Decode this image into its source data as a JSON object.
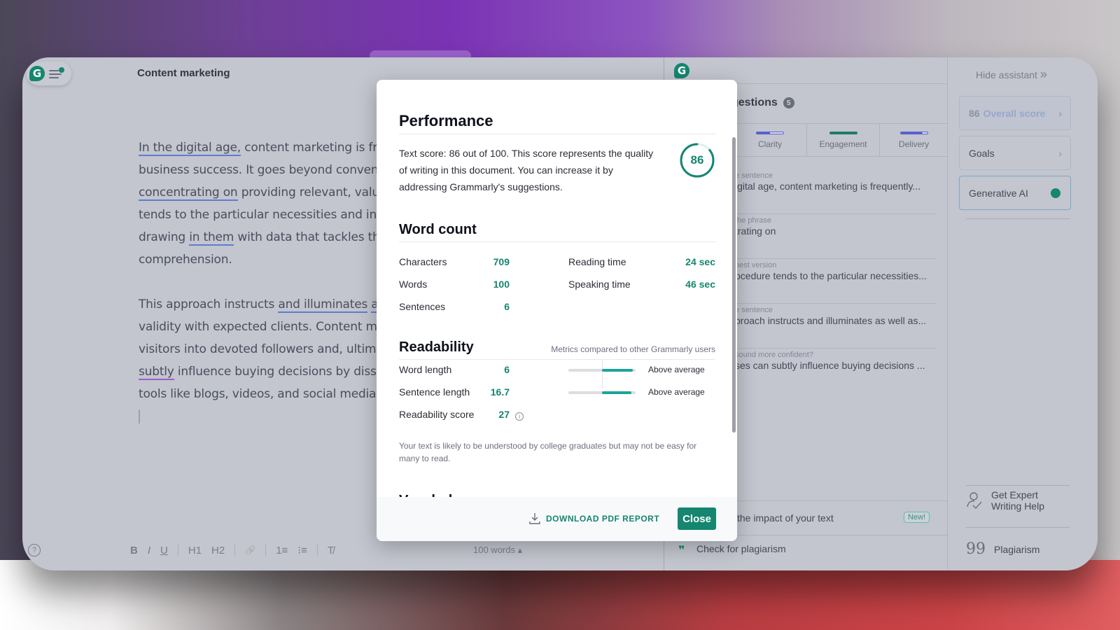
{
  "editor": {
    "doc_title": "Content marketing",
    "paragraph1": {
      "l1": [
        "In the digital age,",
        " content marketing is fre"
      ],
      "l2": "business success. It goes beyond conven",
      "l3": [
        "concentrating on",
        " providing relevant, valua"
      ],
      "l4": "tends to the particular necessities and inte",
      "l5": [
        "drawing ",
        "in them",
        " with data that tackles the"
      ],
      "l6": "comprehension."
    },
    "paragraph2": {
      "l1": [
        "This approach instructs ",
        "and illuminates",
        " ",
        "as"
      ],
      "l2": "validity with expected clients. Content ma",
      "l3": "visitors into devoted followers and, ultima",
      "l4": [
        "subtly",
        " influence buying decisions by disse"
      ],
      "l5": "tools like blogs, videos, and social media."
    },
    "toolbar": {
      "help": "?",
      "bold": "B",
      "italic": "I",
      "underline": "U",
      "h1": "H1",
      "h2": "H2",
      "link": "🔗",
      "ordered_list": "1≡",
      "bullet_list": "⁝≡",
      "clear_format": "T̸"
    },
    "word_count": "100 words ▴"
  },
  "assistant": {
    "suggestions_title": "gestions",
    "suggestions_count": "5",
    "categories": [
      {
        "label": "Clarity",
        "color": "#5a5fcf",
        "progress": 0.5
      },
      {
        "label": "Engagement",
        "color": "#1f7a6b",
        "progress": 1.0
      },
      {
        "label": "Delivery",
        "color": "#5a5fcf",
        "progress": 0.8
      }
    ],
    "suggestions": [
      {
        "kind": "e sentence",
        "text": "igital age, content marketing is frequently..."
      },
      {
        "kind": "the phrase",
        "text": "trating on"
      },
      {
        "kind": "best version",
        "text": "ocedure tends to the particular necessities..."
      },
      {
        "kind": "e sentence",
        "text": "proach instructs and illuminates as well as..."
      },
      {
        "kind": "sound more confident?",
        "text": "ses can subtly influence buying decisions ..."
      }
    ],
    "impact_text": "the impact of your text",
    "new_badge": "New!",
    "plagiarism_check": "Check for plagiarism"
  },
  "side": {
    "hide_assistant": "Hide assistant",
    "hide_icon": "»",
    "overall_score_value": "86",
    "overall_score_label": "Overall score",
    "goals": "Goals",
    "generative_ai": "Generative AI",
    "expert_help": "Get Expert Writing Help",
    "plagiarism": "Plagiarism"
  },
  "modal": {
    "performance_title": "Performance",
    "performance_text": "Text score: 86 out of 100. This score represents the quality of writing in this document. You can increase it by addressing Grammarly's suggestions.",
    "score": "86",
    "score_fraction": 0.86,
    "word_count_title": "Word count",
    "characters_label": "Characters",
    "characters_value": "709",
    "words_label": "Words",
    "words_value": "100",
    "sentences_label": "Sentences",
    "sentences_value": "6",
    "reading_time_label": "Reading time",
    "reading_time_value": "24 sec",
    "speaking_time_label": "Speaking time",
    "speaking_time_value": "46 sec",
    "readability_title": "Readability",
    "readability_sub": "Metrics compared to other Grammarly users",
    "word_length_label": "Word length",
    "word_length_value": "6",
    "word_length_rating": "Above average",
    "sentence_length_label": "Sentence length",
    "sentence_length_value": "16.7",
    "sentence_length_rating": "Above average",
    "readability_score_label": "Readability score",
    "readability_score_value": "27",
    "readability_note": "Your text is likely to be understood by college graduates but may not be easy for many to read.",
    "vocabulary_peek": "Vocabulary",
    "download_label": "DOWNLOAD PDF REPORT",
    "close_label": "Close"
  },
  "colors": {
    "accent": "#15866f",
    "underline_blue": "#5f7ed0",
    "underline_purple": "#9a5fc9"
  }
}
